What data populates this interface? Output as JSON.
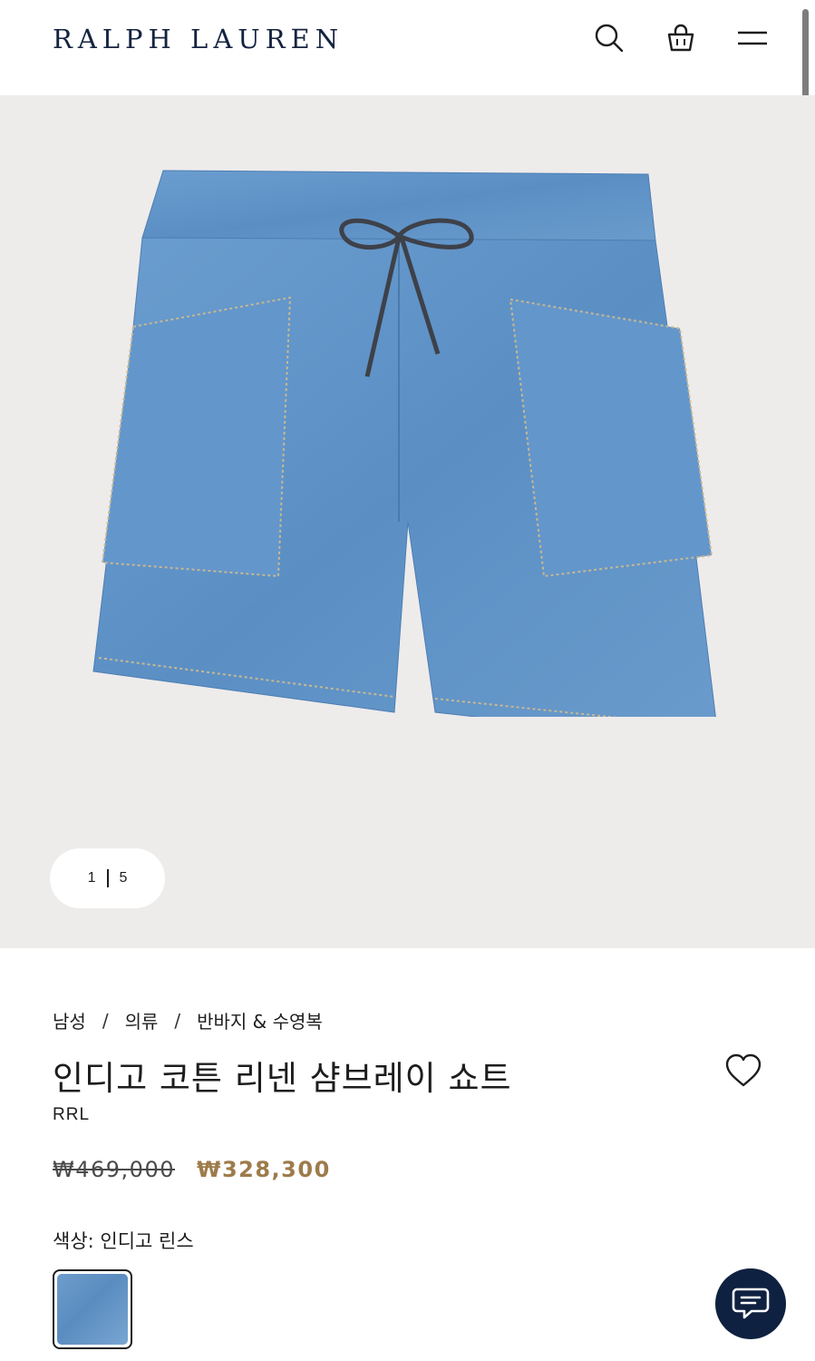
{
  "header": {
    "logo": "RALPH LAUREN",
    "icons": [
      "search-icon",
      "shopping-bag-icon",
      "menu-icon"
    ]
  },
  "gallery": {
    "current": "1",
    "total": "5"
  },
  "breadcrumb": {
    "items": [
      "남성",
      "의류",
      "반바지 & 수영복"
    ],
    "separator": "/"
  },
  "product": {
    "title": "인디고 코튼 리넨 샴브레이 쇼트",
    "brand": "RRL",
    "price_original": "₩469,000",
    "price_sale": "₩328,300",
    "color_label": "색상:",
    "color_value": "인디고 린스"
  },
  "colors": {
    "accent_price": "#9d7b4b",
    "navy": "#0f2140",
    "gallery_bg": "#eeebeb"
  }
}
